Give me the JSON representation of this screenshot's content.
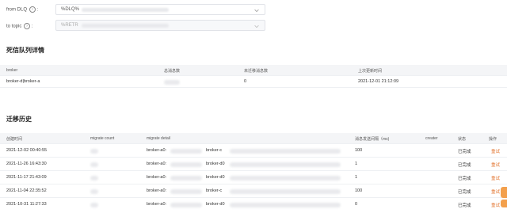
{
  "form": {
    "from_label": "from DLQ",
    "from_value": "%DLQ%",
    "to_label": "to topic",
    "to_value": "%RETR"
  },
  "details": {
    "title": "死信队列详情",
    "headers": [
      "broker",
      "总消息数",
      "未迁移消息数",
      "上次更新时间"
    ],
    "rows": [
      {
        "broker": "broker-d|broker-a",
        "total": "",
        "unmigrated": "0",
        "updated": "2021-12-01 21:12:09"
      }
    ]
  },
  "history": {
    "title": "迁移历史",
    "headers": [
      "创建时间",
      "migrate count",
      "migrate detail",
      "消息发送间隔（ms)",
      "creater",
      "状态",
      "操作"
    ],
    "rows": [
      {
        "created": "2021-12-02 00:40:55",
        "detail_a": "broker-a0:",
        "detail_b": "broker-c",
        "interval": "100",
        "status": "已完成",
        "action": "重试"
      },
      {
        "created": "2021-11-26 16:43:30",
        "detail_a": "broker-a0:",
        "detail_b": "broker-d0",
        "interval": "1",
        "status": "已完成",
        "action": "重试"
      },
      {
        "created": "2021-11-17 21:43:09",
        "detail_a": "broker-a0:",
        "detail_b": "broker-d0",
        "interval": "1",
        "status": "已完成",
        "action": "重试"
      },
      {
        "created": "2021-11-04 22:35:52",
        "detail_a": "broker-a0:",
        "detail_b": "broker-c",
        "interval": "100",
        "status": "已完成",
        "action": "重试"
      },
      {
        "created": "2021-10-31 11:27:33",
        "detail_a": "broker-a0:",
        "detail_b": "broker-d0",
        "interval": "0",
        "status": "已完成",
        "action": "重试"
      }
    ]
  },
  "icons": {
    "help": "help-circle-icon",
    "chevron": "chevron-down-icon"
  },
  "colors": {
    "accent": "#e2742e",
    "header_bg": "#f4f5f7",
    "float_button": "#f3a04c"
  }
}
